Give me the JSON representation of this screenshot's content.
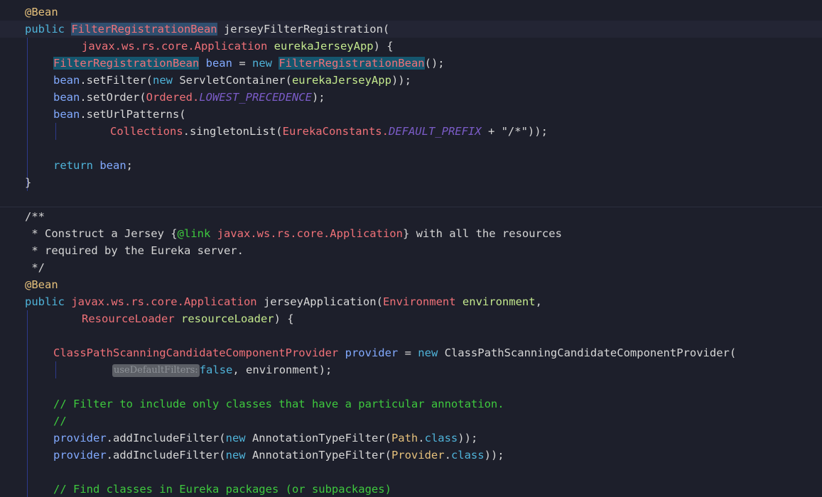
{
  "editor": {
    "line1": {
      "ann": "@Bean"
    },
    "line2": {
      "kw": "public ",
      "type": "FilterRegistrationBean",
      "rest": " jerseyFilterRegistration("
    },
    "line3": {
      "type": "javax.ws.rs.core.Application",
      "param": " eurekaJerseyApp",
      "rest": ") {"
    },
    "line4": {
      "type": "FilterRegistrationBean",
      "var": " bean",
      "eq": " = ",
      "kw": "new ",
      "type2": "FilterRegistrationBean",
      "rest": "();"
    },
    "line5": {
      "var": "bean",
      "m": ".setFilter(",
      "kw": "new ",
      "cls": "ServletContainer(",
      "arg": "eurekaJerseyApp",
      "rest": "));"
    },
    "line6": {
      "var": "bean",
      "m": ".setOrder(",
      "cls": "Ordered.",
      "const": "LOWEST_PRECEDENCE",
      "rest": ");"
    },
    "line7": {
      "var": "bean",
      "m": ".setUrlPatterns("
    },
    "line8": {
      "cls": "Collections",
      "m": ".singletonList(",
      "cls2": "EurekaConstants.",
      "const": "DEFAULT_PREFIX",
      "rest": " + \"/*\"));"
    },
    "line10": {
      "kw": "return ",
      "var": "bean",
      "rest": ";"
    },
    "line11": {
      "text": "}"
    },
    "line13": {
      "text": "/**"
    },
    "line14": {
      "pre": " * Construct a Jersey {",
      "tag": "@link",
      "ref": " javax.ws.rs.core.Application",
      "post": "} with all the resources"
    },
    "line15": {
      "text": " * required by the Eureka server."
    },
    "line16": {
      "text": " */"
    },
    "line17": {
      "ann": "@Bean"
    },
    "line18": {
      "kw": "public ",
      "type": "javax.ws.rs.core.Application",
      "rest": " jerseyApplication(",
      "ptype": "Environment",
      "param": " environment",
      "tail": ","
    },
    "line19": {
      "ptype": "ResourceLoader",
      "param": " resourceLoader",
      "rest": ") {"
    },
    "line21": {
      "type": "ClassPathScanningCandidateComponentProvider",
      "var": " provider",
      "eq": " = ",
      "kw": "new ",
      "rest": "ClassPathScanningCandidateComponentProvider("
    },
    "line22": {
      "hint": "useDefaultFilters:",
      "kw": "false",
      "rest": ", environment);"
    },
    "line24": {
      "text": "// Filter to include only classes that have a particular annotation."
    },
    "line25": {
      "text": "//"
    },
    "line26": {
      "var": "provider",
      "m": ".addIncludeFilter(",
      "kw": "new ",
      "cls": "AnnotationTypeFilter(",
      "ann": "Path",
      "dot": ".",
      "kw2": "class",
      "rest": "));"
    },
    "line27": {
      "var": "provider",
      "m": ".addIncludeFilter(",
      "kw": "new ",
      "cls": "AnnotationTypeFilter(",
      "ann": "Provider",
      "dot": ".",
      "kw2": "class",
      "rest": "));"
    },
    "line29": {
      "text": "// Find classes in Eureka packages (or subpackages)"
    }
  }
}
